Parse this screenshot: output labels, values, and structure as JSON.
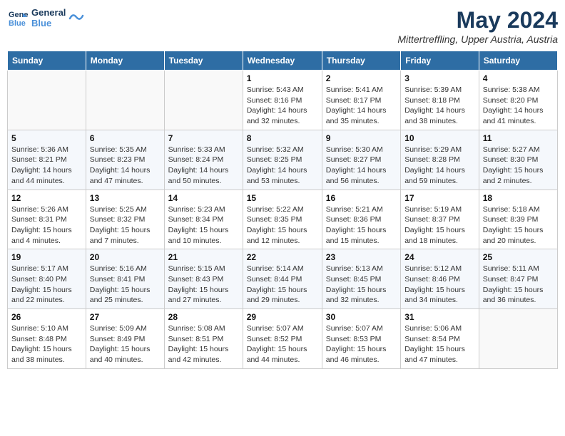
{
  "header": {
    "logo_line1": "General",
    "logo_line2": "Blue",
    "month_title": "May 2024",
    "location": "Mittertreffling, Upper Austria, Austria"
  },
  "weekdays": [
    "Sunday",
    "Monday",
    "Tuesday",
    "Wednesday",
    "Thursday",
    "Friday",
    "Saturday"
  ],
  "weeks": [
    [
      {
        "day": "",
        "info": ""
      },
      {
        "day": "",
        "info": ""
      },
      {
        "day": "",
        "info": ""
      },
      {
        "day": "1",
        "info": "Sunrise: 5:43 AM\nSunset: 8:16 PM\nDaylight: 14 hours\nand 32 minutes."
      },
      {
        "day": "2",
        "info": "Sunrise: 5:41 AM\nSunset: 8:17 PM\nDaylight: 14 hours\nand 35 minutes."
      },
      {
        "day": "3",
        "info": "Sunrise: 5:39 AM\nSunset: 8:18 PM\nDaylight: 14 hours\nand 38 minutes."
      },
      {
        "day": "4",
        "info": "Sunrise: 5:38 AM\nSunset: 8:20 PM\nDaylight: 14 hours\nand 41 minutes."
      }
    ],
    [
      {
        "day": "5",
        "info": "Sunrise: 5:36 AM\nSunset: 8:21 PM\nDaylight: 14 hours\nand 44 minutes."
      },
      {
        "day": "6",
        "info": "Sunrise: 5:35 AM\nSunset: 8:23 PM\nDaylight: 14 hours\nand 47 minutes."
      },
      {
        "day": "7",
        "info": "Sunrise: 5:33 AM\nSunset: 8:24 PM\nDaylight: 14 hours\nand 50 minutes."
      },
      {
        "day": "8",
        "info": "Sunrise: 5:32 AM\nSunset: 8:25 PM\nDaylight: 14 hours\nand 53 minutes."
      },
      {
        "day": "9",
        "info": "Sunrise: 5:30 AM\nSunset: 8:27 PM\nDaylight: 14 hours\nand 56 minutes."
      },
      {
        "day": "10",
        "info": "Sunrise: 5:29 AM\nSunset: 8:28 PM\nDaylight: 14 hours\nand 59 minutes."
      },
      {
        "day": "11",
        "info": "Sunrise: 5:27 AM\nSunset: 8:30 PM\nDaylight: 15 hours\nand 2 minutes."
      }
    ],
    [
      {
        "day": "12",
        "info": "Sunrise: 5:26 AM\nSunset: 8:31 PM\nDaylight: 15 hours\nand 4 minutes."
      },
      {
        "day": "13",
        "info": "Sunrise: 5:25 AM\nSunset: 8:32 PM\nDaylight: 15 hours\nand 7 minutes."
      },
      {
        "day": "14",
        "info": "Sunrise: 5:23 AM\nSunset: 8:34 PM\nDaylight: 15 hours\nand 10 minutes."
      },
      {
        "day": "15",
        "info": "Sunrise: 5:22 AM\nSunset: 8:35 PM\nDaylight: 15 hours\nand 12 minutes."
      },
      {
        "day": "16",
        "info": "Sunrise: 5:21 AM\nSunset: 8:36 PM\nDaylight: 15 hours\nand 15 minutes."
      },
      {
        "day": "17",
        "info": "Sunrise: 5:19 AM\nSunset: 8:37 PM\nDaylight: 15 hours\nand 18 minutes."
      },
      {
        "day": "18",
        "info": "Sunrise: 5:18 AM\nSunset: 8:39 PM\nDaylight: 15 hours\nand 20 minutes."
      }
    ],
    [
      {
        "day": "19",
        "info": "Sunrise: 5:17 AM\nSunset: 8:40 PM\nDaylight: 15 hours\nand 22 minutes."
      },
      {
        "day": "20",
        "info": "Sunrise: 5:16 AM\nSunset: 8:41 PM\nDaylight: 15 hours\nand 25 minutes."
      },
      {
        "day": "21",
        "info": "Sunrise: 5:15 AM\nSunset: 8:43 PM\nDaylight: 15 hours\nand 27 minutes."
      },
      {
        "day": "22",
        "info": "Sunrise: 5:14 AM\nSunset: 8:44 PM\nDaylight: 15 hours\nand 29 minutes."
      },
      {
        "day": "23",
        "info": "Sunrise: 5:13 AM\nSunset: 8:45 PM\nDaylight: 15 hours\nand 32 minutes."
      },
      {
        "day": "24",
        "info": "Sunrise: 5:12 AM\nSunset: 8:46 PM\nDaylight: 15 hours\nand 34 minutes."
      },
      {
        "day": "25",
        "info": "Sunrise: 5:11 AM\nSunset: 8:47 PM\nDaylight: 15 hours\nand 36 minutes."
      }
    ],
    [
      {
        "day": "26",
        "info": "Sunrise: 5:10 AM\nSunset: 8:48 PM\nDaylight: 15 hours\nand 38 minutes."
      },
      {
        "day": "27",
        "info": "Sunrise: 5:09 AM\nSunset: 8:49 PM\nDaylight: 15 hours\nand 40 minutes."
      },
      {
        "day": "28",
        "info": "Sunrise: 5:08 AM\nSunset: 8:51 PM\nDaylight: 15 hours\nand 42 minutes."
      },
      {
        "day": "29",
        "info": "Sunrise: 5:07 AM\nSunset: 8:52 PM\nDaylight: 15 hours\nand 44 minutes."
      },
      {
        "day": "30",
        "info": "Sunrise: 5:07 AM\nSunset: 8:53 PM\nDaylight: 15 hours\nand 46 minutes."
      },
      {
        "day": "31",
        "info": "Sunrise: 5:06 AM\nSunset: 8:54 PM\nDaylight: 15 hours\nand 47 minutes."
      },
      {
        "day": "",
        "info": ""
      }
    ]
  ]
}
